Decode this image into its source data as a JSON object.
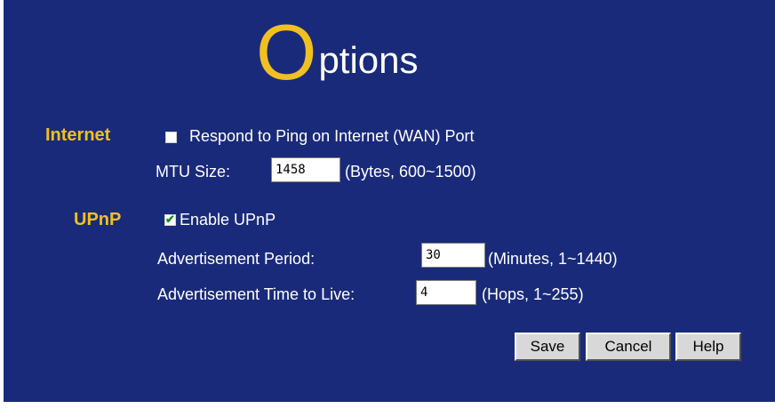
{
  "title": {
    "first_letter": "O",
    "rest": "ptions"
  },
  "internet": {
    "label": "Internet",
    "ping_checkbox": {
      "label": "Respond to Ping on Internet (WAN) Port",
      "checked": false
    },
    "mtu": {
      "label": "MTU Size:",
      "value": "1458",
      "unit": "(Bytes, 600~1500)"
    }
  },
  "upnp": {
    "label": "UPnP",
    "enable_checkbox": {
      "label": "Enable UPnP",
      "checked": true
    },
    "advertisement_period": {
      "label": "Advertisement Period:",
      "value": "30",
      "unit": "(Minutes, 1~1440)"
    },
    "advertisement_ttl": {
      "label": "Advertisement Time to Live:",
      "value": "4",
      "unit": "(Hops, 1~255)"
    }
  },
  "buttons": {
    "save": "Save",
    "cancel": "Cancel",
    "help": "Help"
  },
  "colors": {
    "background": "#1a2a7a",
    "accent": "#f0c020",
    "text": "#ffffff"
  }
}
